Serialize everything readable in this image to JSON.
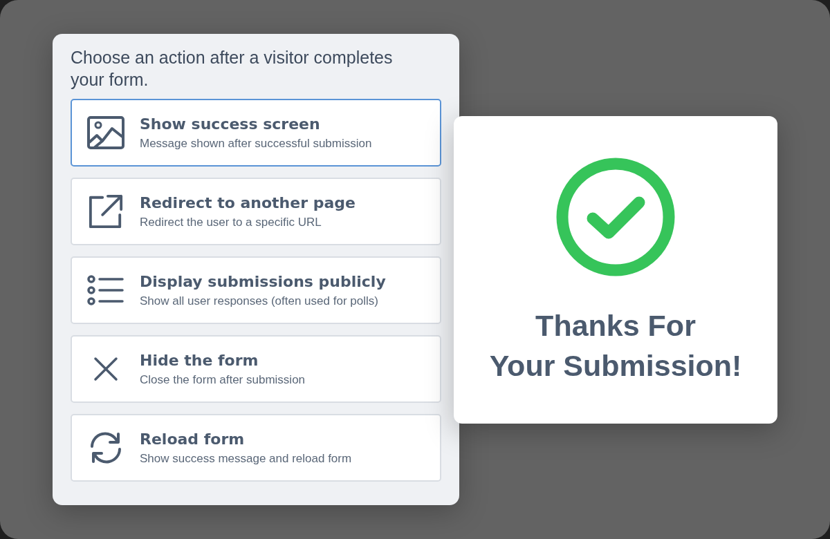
{
  "panel": {
    "prompt": "Choose an action after a visitor completes your form."
  },
  "options": [
    {
      "kind": "image",
      "title": "Show success screen",
      "description": "Message shown after successful submission",
      "selected": true
    },
    {
      "kind": "external",
      "title": "Redirect to another page",
      "description": "Redirect the user to a specific URL",
      "selected": false
    },
    {
      "kind": "list",
      "title": "Display submissions publicly",
      "description": "Show all user responses (often used for polls)",
      "selected": false
    },
    {
      "kind": "close",
      "title": "Hide the form",
      "description": "Close the form after submission",
      "selected": false
    },
    {
      "kind": "reload",
      "title": "Reload form",
      "description": "Show success message and reload form",
      "selected": false
    }
  ],
  "success_card": {
    "message_lines": [
      "Thanks For",
      "Your Submission!"
    ]
  }
}
